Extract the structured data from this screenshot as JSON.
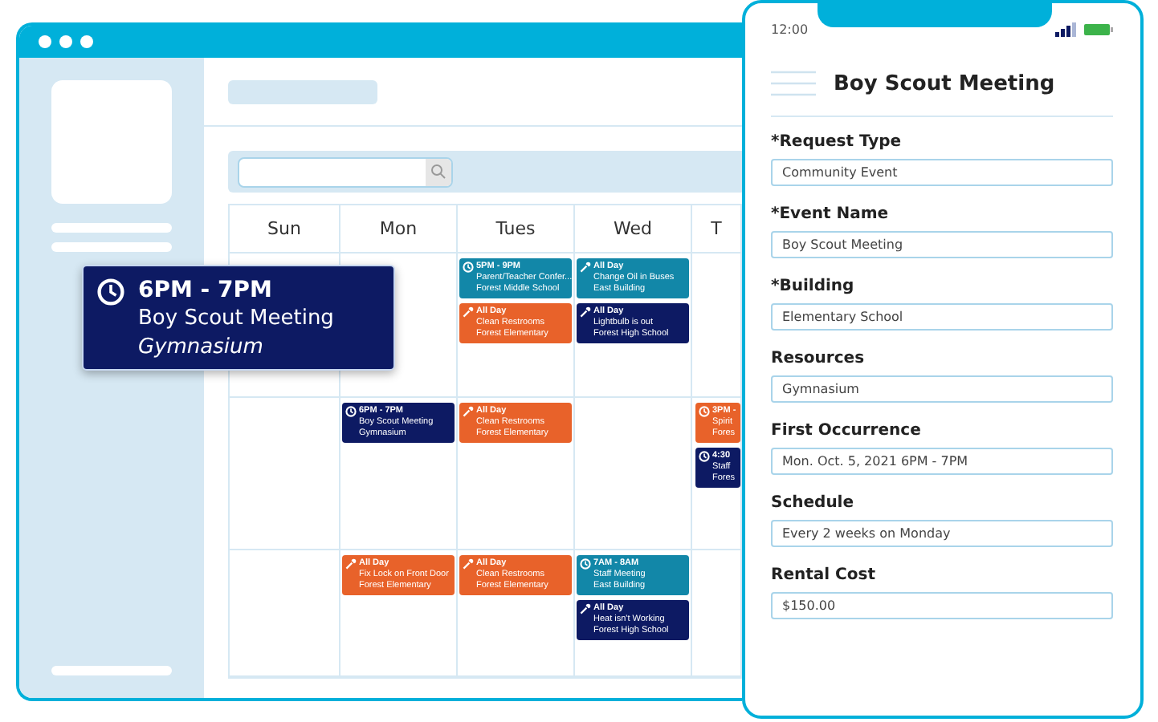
{
  "calendar": {
    "days": [
      "Sun",
      "Mon",
      "Tues",
      "Wed",
      "T"
    ],
    "weeks": [
      {
        "tues": [
          {
            "kind": "time",
            "time": "5PM - 9PM",
            "title": "Parent/Teacher Confer...",
            "location": "Forest Middle School",
            "color": "#1287a8"
          },
          {
            "kind": "allday",
            "time": "All Day",
            "title": "Clean Restrooms",
            "location": "Forest Elementary",
            "color": "#e8622a"
          }
        ],
        "wed": [
          {
            "kind": "allday",
            "time": "All Day",
            "title": "Change Oil in Buses",
            "location": "East Building",
            "color": "#1287a8"
          },
          {
            "kind": "allday",
            "time": "All Day",
            "title": "Lightbulb is out",
            "location": "Forest High School",
            "color": "#0d1a63"
          }
        ]
      },
      {
        "mon": [
          {
            "kind": "time",
            "time": "6PM - 7PM",
            "title": "Boy Scout Meeting",
            "location": "Gymnasium",
            "color": "#0d1a63"
          }
        ],
        "tues": [
          {
            "kind": "allday",
            "time": "All Day",
            "title": "Clean Restrooms",
            "location": "Forest Elementary",
            "color": "#e8622a"
          }
        ],
        "thu": [
          {
            "kind": "time",
            "time": "3PM -",
            "title": "Spirit",
            "location": "Fores",
            "color": "#e8622a"
          },
          {
            "kind": "time",
            "time": "4:30",
            "title": "Staff",
            "location": "Fores",
            "color": "#0d1a63"
          }
        ]
      },
      {
        "mon": [
          {
            "kind": "allday",
            "time": "All Day",
            "title": "Fix Lock on Front Door",
            "location": "Forest Elementary",
            "color": "#e8622a"
          }
        ],
        "tues": [
          {
            "kind": "allday",
            "time": "All Day",
            "title": "Clean Restrooms",
            "location": "Forest Elementary",
            "color": "#e8622a"
          }
        ],
        "wed": [
          {
            "kind": "time",
            "time": "7AM - 8AM",
            "title": "Staff Meeting",
            "location": "East Building",
            "color": "#1287a8"
          },
          {
            "kind": "allday",
            "time": "All Day",
            "title": "Heat isn't Working",
            "location": "Forest High School",
            "color": "#0d1a63"
          }
        ]
      }
    ]
  },
  "popup": {
    "time": "6PM - 7PM",
    "title": "Boy Scout Meeting",
    "location": "Gymnasium"
  },
  "phone": {
    "clock": "12:00",
    "title": "Boy Scout Meeting",
    "fields": [
      {
        "label": "*Request Type",
        "value": "Community Event"
      },
      {
        "label": "*Event Name",
        "value": "Boy Scout Meeting"
      },
      {
        "label": "*Building",
        "value": "Elementary School"
      },
      {
        "label": "Resources",
        "value": "Gymnasium"
      },
      {
        "label": "First Occurrence",
        "value": "Mon. Oct. 5, 2021 6PM - 7PM"
      },
      {
        "label": "Schedule",
        "value": "Every 2 weeks on Monday"
      },
      {
        "label": "Rental Cost",
        "value": "$150.00"
      }
    ]
  }
}
